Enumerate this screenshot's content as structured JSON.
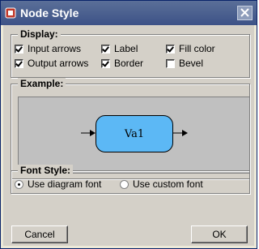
{
  "window": {
    "title": "Node Style",
    "title_bar_color": "#4b5d92",
    "close_icon": "close-icon"
  },
  "display": {
    "title": "Display:",
    "options": [
      {
        "label": "Input arrows",
        "checked": true
      },
      {
        "label": "Label",
        "checked": true
      },
      {
        "label": "Fill color",
        "checked": true
      },
      {
        "label": "Output arrows",
        "checked": true
      },
      {
        "label": "Border",
        "checked": true
      },
      {
        "label": "Bevel",
        "checked": false
      }
    ]
  },
  "example": {
    "title": "Example:",
    "node_label": "Va1",
    "node_fill": "#5cb8f5",
    "background": "#c0c0c0"
  },
  "font_style": {
    "title": "Font Style:",
    "options": [
      {
        "label": "Use diagram font",
        "selected": true
      },
      {
        "label": "Use custom font",
        "selected": false
      }
    ]
  },
  "buttons": {
    "cancel": "Cancel",
    "ok": "OK"
  }
}
